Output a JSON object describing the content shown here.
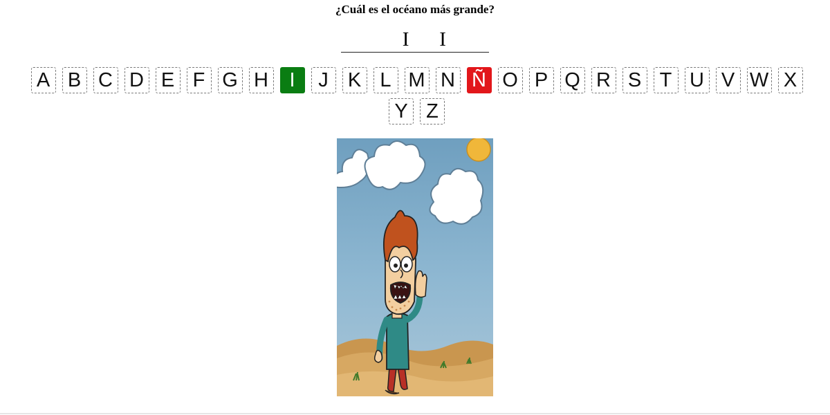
{
  "question": "¿Cuál es el océano más grande?",
  "word_slots": [
    "",
    "",
    "",
    "I",
    "",
    "I",
    "",
    ""
  ],
  "keys": [
    {
      "letter": "A",
      "state": "default"
    },
    {
      "letter": "B",
      "state": "default"
    },
    {
      "letter": "C",
      "state": "default"
    },
    {
      "letter": "D",
      "state": "default"
    },
    {
      "letter": "E",
      "state": "default"
    },
    {
      "letter": "F",
      "state": "default"
    },
    {
      "letter": "G",
      "state": "default"
    },
    {
      "letter": "H",
      "state": "default"
    },
    {
      "letter": "I",
      "state": "correct"
    },
    {
      "letter": "J",
      "state": "default"
    },
    {
      "letter": "K",
      "state": "default"
    },
    {
      "letter": "L",
      "state": "default"
    },
    {
      "letter": "M",
      "state": "default"
    },
    {
      "letter": "N",
      "state": "default"
    },
    {
      "letter": "Ñ",
      "state": "wrong"
    },
    {
      "letter": "O",
      "state": "default"
    },
    {
      "letter": "P",
      "state": "default"
    },
    {
      "letter": "Q",
      "state": "default"
    },
    {
      "letter": "R",
      "state": "default"
    },
    {
      "letter": "S",
      "state": "default"
    },
    {
      "letter": "T",
      "state": "default"
    },
    {
      "letter": "U",
      "state": "default"
    },
    {
      "letter": "V",
      "state": "default"
    },
    {
      "letter": "W",
      "state": "default"
    },
    {
      "letter": "X",
      "state": "default"
    },
    {
      "letter": "Y",
      "state": "default"
    },
    {
      "letter": "Z",
      "state": "default"
    }
  ],
  "colors": {
    "correct": "#0a7d12",
    "wrong": "#e2171b",
    "sky": "#8fb8d2",
    "sand": "#d7a862",
    "cloud": "#ffffff"
  },
  "illustration": {
    "icon": "hangman-character-scene-icon",
    "stage": "head-and-body"
  }
}
